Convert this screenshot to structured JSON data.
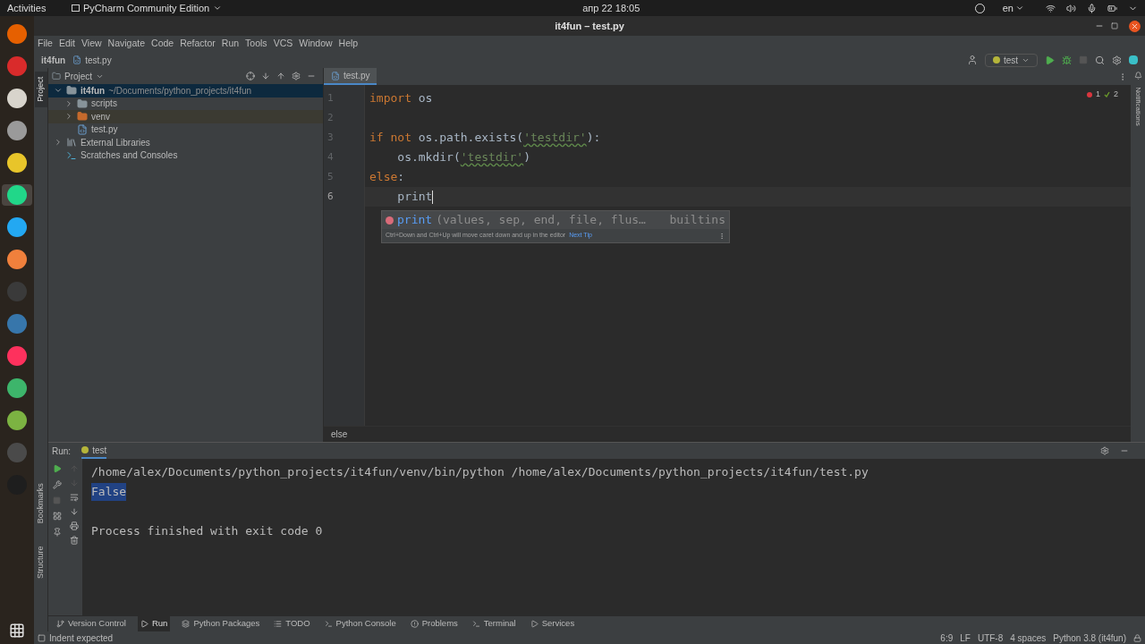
{
  "topbar": {
    "activities": "Activities",
    "app": "PyCharm Community Edition",
    "clock": "апр 22  18:05",
    "lang": "en"
  },
  "dock": [
    {
      "color": "#e66000",
      "selected": false
    },
    {
      "color": "#d92b2b",
      "selected": false
    },
    {
      "color": "#d8d4cc",
      "selected": false
    },
    {
      "color": "#9a9a9a",
      "selected": false
    },
    {
      "color": "#e8c52a",
      "selected": false
    },
    {
      "color": "#21d789",
      "selected": true
    },
    {
      "color": "#23a8f2",
      "selected": false
    },
    {
      "color": "#f0803c",
      "selected": false
    },
    {
      "color": "#3a3a3a",
      "selected": false
    },
    {
      "color": "#3776ab",
      "selected": false
    },
    {
      "color": "#fe315d",
      "selected": false
    },
    {
      "color": "#3db56b",
      "selected": false
    },
    {
      "color": "#7cb342",
      "selected": false
    },
    {
      "color": "#4a4a4a",
      "selected": false
    },
    {
      "color": "#1e1e1e",
      "selected": false
    }
  ],
  "window": {
    "title": "it4fun – test.py"
  },
  "menu": [
    "File",
    "Edit",
    "View",
    "Navigate",
    "Code",
    "Refactor",
    "Run",
    "Tools",
    "VCS",
    "Window",
    "Help"
  ],
  "breadcrumbs": [
    "it4fun",
    "test.py"
  ],
  "run_config": "test",
  "project_panel": {
    "title": "Project",
    "stripe_label": "Project",
    "tree": [
      {
        "label": "it4fun",
        "path": "~/Documents/python_projects/it4fun",
        "kind": "folder",
        "expanded": true,
        "selected": true,
        "children": [
          {
            "label": "scripts",
            "kind": "folder",
            "expanded": false,
            "selected": false
          },
          {
            "label": "venv",
            "kind": "excluded",
            "expanded": false,
            "selected": false
          },
          {
            "label": "test.py",
            "kind": "file",
            "selected": false
          }
        ]
      },
      {
        "label": "External Libraries",
        "kind": "library",
        "expanded": false,
        "selected": false
      },
      {
        "label": "Scratches and Consoles",
        "kind": "scratches",
        "selected": false
      }
    ]
  },
  "editor": {
    "tab": "test.py",
    "errors": "1",
    "warnings": "2",
    "lines": [
      {
        "number": "1",
        "current": false,
        "tokens": [
          {
            "text": "import",
            "kind": "keyword"
          },
          {
            "text": " os",
            "kind": "plain"
          }
        ]
      },
      {
        "number": "2",
        "current": false
      },
      {
        "number": "3",
        "current": false,
        "tokens": [
          {
            "text": "if not",
            "kind": "keyword"
          },
          {
            "text": " os.path.exists(",
            "kind": "plain"
          },
          {
            "text": "'testdir'",
            "kind": "string"
          },
          {
            "text": "):",
            "kind": "plain"
          }
        ]
      },
      {
        "number": "4",
        "current": false,
        "tokens": [
          {
            "text": "    os.mkdir(",
            "kind": "plain"
          },
          {
            "text": "'testdir'",
            "kind": "string"
          },
          {
            "text": ")",
            "kind": "plain"
          }
        ]
      },
      {
        "number": "5",
        "current": false,
        "tokens": [
          {
            "text": "else",
            "kind": "keyword"
          },
          {
            "text": ":",
            "kind": "plain"
          }
        ]
      },
      {
        "number": "6",
        "current": true,
        "tokens": [
          {
            "text": "    print",
            "kind": "plain"
          }
        ]
      }
    ],
    "completion": {
      "name": "print",
      "params": "(values, sep, end, file, flus…",
      "source": "builtins",
      "hint": "Ctrl+Down and Ctrl+Up will move caret down and up in the editor",
      "link": "Next Tip"
    },
    "breadcrumb": "else"
  },
  "right_stripe": "Notifications",
  "run_panel": {
    "label": "Run:",
    "tab": "test",
    "console": [
      {
        "text": "/home/alex/Documents/python_projects/it4fun/venv/bin/python /home/alex/Documents/python_projects/it4fun/test.py",
        "selected": false
      },
      {
        "text": "False",
        "selected": true
      },
      {
        "text": "Process finished with exit code 0",
        "selected": false
      }
    ]
  },
  "left_stripe_bottom": [
    "Bookmarks",
    "Structure"
  ],
  "tool_tabs": [
    {
      "label": "Version Control",
      "selected": false
    },
    {
      "label": "Run",
      "selected": true
    },
    {
      "label": "Python Packages",
      "selected": false
    },
    {
      "label": "TODO",
      "selected": false
    },
    {
      "label": "Python Console",
      "selected": false
    },
    {
      "label": "Problems",
      "selected": false
    },
    {
      "label": "Terminal",
      "selected": false
    },
    {
      "label": "Services",
      "selected": false
    }
  ],
  "status_bar": {
    "message": "Indent expected",
    "items": [
      "6:9",
      "LF",
      "UTF-8",
      "4 spaces",
      "Python 3.8 (it4fun)"
    ]
  }
}
